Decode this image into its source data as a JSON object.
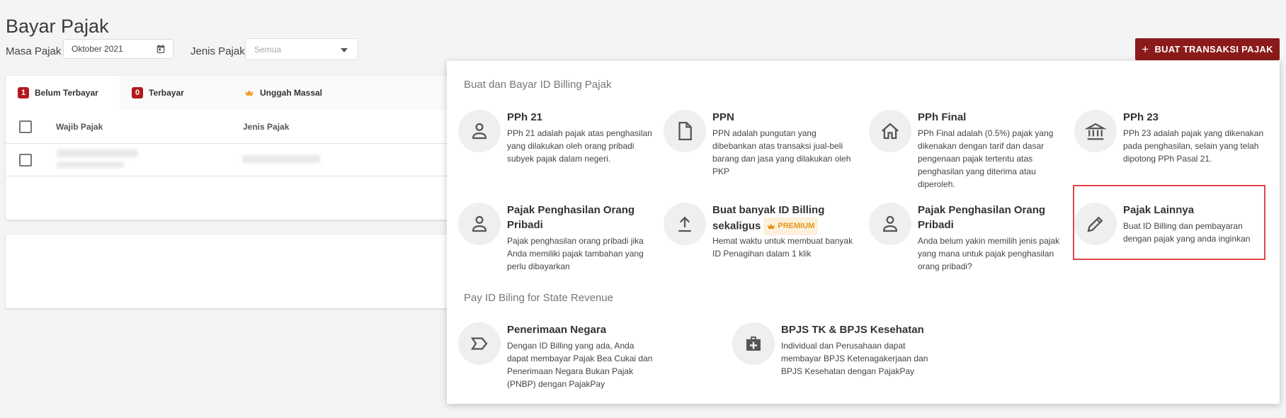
{
  "page": {
    "title": "Bayar Pajak"
  },
  "filters": {
    "masa_label": "Masa Pajak",
    "masa_value": "Oktober 2021",
    "jenis_label": "Jenis Pajak",
    "jenis_value": "Semua"
  },
  "actions": {
    "create_label": "BUAT TRANSAKSI PAJAK"
  },
  "tabs": [
    {
      "badge": "1",
      "label": "Belum Terbayar"
    },
    {
      "badge": "0",
      "label": "Terbayar"
    },
    {
      "label": "Unggah Massal",
      "icon": "crown-icon"
    }
  ],
  "table": {
    "columns": [
      "Wajib Pajak",
      "Jenis Pajak"
    ]
  },
  "popover": {
    "section1_title": "Buat dan Bayar ID Billing Pajak",
    "section2_title": "Pay ID Biling for State Revenue",
    "items": [
      {
        "icon": "person-icon",
        "title": "PPh 21",
        "desc": "PPh 21 adalah pajak atas penghasilan yang dilakukan oleh orang pribadi subyek pajak dalam negeri."
      },
      {
        "icon": "document-icon",
        "title": "PPN",
        "desc": "PPN adalah pungutan yang dibebankan atas transaksi jual-beli barang dan jasa yang dilakukan oleh PKP"
      },
      {
        "icon": "home-icon",
        "title": "PPh Final",
        "desc": "PPh Final adalah (0.5%) pajak yang dikenakan dengan tarif dan dasar pengenaan pajak tertentu atas penghasilan yang diterima atau diperoleh."
      },
      {
        "icon": "bank-icon",
        "title": "PPh 23",
        "desc": "PPh 23 adalah pajak yang dikenakan pada penghasilan, selain yang telah dipotong PPh Pasal 21."
      },
      {
        "icon": "person-icon",
        "title": "Pajak Penghasilan Orang Pribadi",
        "desc": "Pajak penghasilan orang pribadi jika Anda memiliki pajak tambahan yang perlu dibayarkan"
      },
      {
        "icon": "upload-icon",
        "title": "Buat banyak ID Billing sekaligus",
        "badge": "PREMIUM",
        "desc": "Hemat waktu untuk membuat banyak ID Penagihan dalam 1 klik"
      },
      {
        "icon": "person-icon",
        "title": "Pajak Penghasilan Orang Pribadi",
        "desc": "Anda belum yakin memilih jenis pajak yang mana untuk pajak penghasilan orang pribadi?"
      },
      {
        "icon": "pencil-icon",
        "title": "Pajak Lainnya",
        "desc": "Buat ID Billing dan pembayaran dengan pajak yang anda inginkan"
      },
      {
        "icon": "label-icon",
        "title": "Penerimaan Negara",
        "desc": "Dengan ID Billing yang ada, Anda dapat membayar Pajak Bea Cukai dan Penerimaan Negara Bukan Pajak (PNBP) dengan PajakPay"
      },
      {
        "icon": "medical-bag-icon",
        "title": "BPJS TK & BPJS Kesehatan",
        "desc": "Individual dan Perusahaan dapat membayar BPJS Ketenagakerjaan dan BPJS Kesehatan dengan PajakPay"
      }
    ]
  },
  "colors": {
    "brand": "#8b1a1a",
    "badge": "#b3191f",
    "premium": "#e6951b",
    "highlight": "#e04545"
  }
}
